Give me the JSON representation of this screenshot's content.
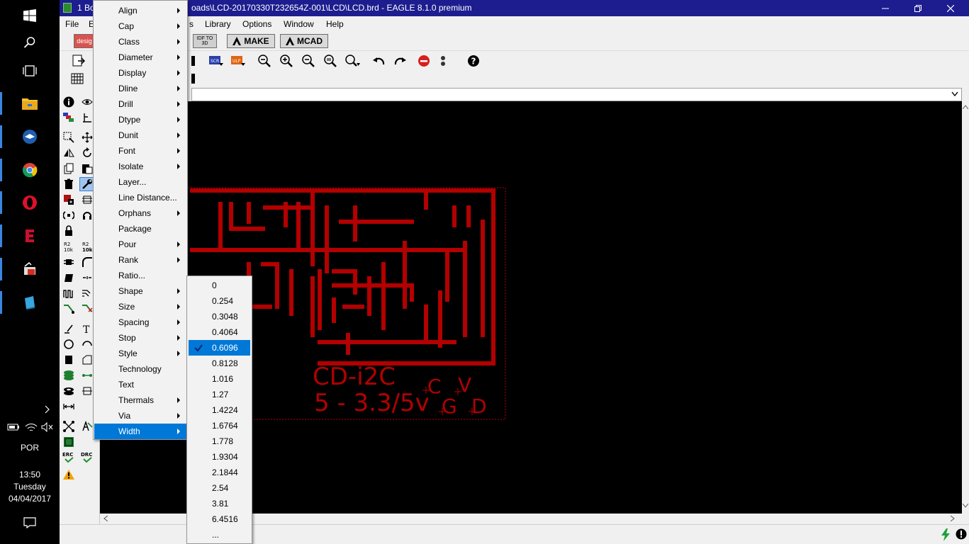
{
  "taskbar": {
    "language": "POR",
    "time": "13:50",
    "day": "Tuesday",
    "date": "04/04/2017"
  },
  "window": {
    "title": "oads\\LCD-20170330T232654Z-001\\LCD\\LCD.brd - EAGLE 8.1.0 premium",
    "title_prefix": "1 Bo",
    "titlebar_color": "#1d1d8f"
  },
  "menubar": {
    "items": [
      "File",
      "E",
      "s",
      "Library",
      "Options",
      "Window",
      "Help"
    ]
  },
  "toolbar": {
    "design_label": "desig",
    "idf_label": "IDF TO 3D",
    "make_label": "MAKE",
    "mcad_label": "MCAD",
    "scr_label": "SCR",
    "ulp_label": "ULP"
  },
  "board": {
    "trace_color": "#b30000",
    "label_line1": "CD-i2C",
    "label_line2": "5 - 3.3/5v",
    "pins": [
      "C",
      "V",
      "G",
      "D"
    ]
  },
  "change_menu": {
    "items": [
      {
        "label": "Align",
        "submenu": true
      },
      {
        "label": "Cap",
        "submenu": true
      },
      {
        "label": "Class",
        "submenu": true
      },
      {
        "label": "Diameter",
        "submenu": true
      },
      {
        "label": "Display",
        "submenu": true
      },
      {
        "label": "Dline",
        "submenu": true
      },
      {
        "label": "Drill",
        "submenu": true
      },
      {
        "label": "Dtype",
        "submenu": true
      },
      {
        "label": "Dunit",
        "submenu": true
      },
      {
        "label": "Font",
        "submenu": true
      },
      {
        "label": "Isolate",
        "submenu": true
      },
      {
        "label": "Layer...",
        "submenu": false
      },
      {
        "label": "Line Distance...",
        "submenu": false
      },
      {
        "label": "Orphans",
        "submenu": true
      },
      {
        "label": "Package",
        "submenu": false
      },
      {
        "label": "Pour",
        "submenu": true
      },
      {
        "label": "Rank",
        "submenu": true
      },
      {
        "label": "Ratio...",
        "submenu": false
      },
      {
        "label": "Shape",
        "submenu": true
      },
      {
        "label": "Size",
        "submenu": true
      },
      {
        "label": "Spacing",
        "submenu": true
      },
      {
        "label": "Stop",
        "submenu": true
      },
      {
        "label": "Style",
        "submenu": true
      },
      {
        "label": "Technology",
        "submenu": false
      },
      {
        "label": "Text",
        "submenu": false
      },
      {
        "label": "Thermals",
        "submenu": true
      },
      {
        "label": "Via",
        "submenu": true
      },
      {
        "label": "Width",
        "submenu": true,
        "selected": true
      }
    ]
  },
  "width_menu": {
    "items": [
      {
        "label": "0"
      },
      {
        "label": "0.254"
      },
      {
        "label": "0.3048"
      },
      {
        "label": "0.4064"
      },
      {
        "label": "0.6096",
        "checked": true
      },
      {
        "label": "0.8128"
      },
      {
        "label": "1.016"
      },
      {
        "label": "1.27"
      },
      {
        "label": "1.4224"
      },
      {
        "label": "1.6764"
      },
      {
        "label": "1.778"
      },
      {
        "label": "1.9304"
      },
      {
        "label": "2.1844"
      },
      {
        "label": "2.54"
      },
      {
        "label": "3.81"
      },
      {
        "label": "6.4516"
      },
      {
        "label": "..."
      }
    ]
  },
  "colors": {
    "selection": "#0078d7",
    "menu_bg": "#f2f2f2"
  }
}
